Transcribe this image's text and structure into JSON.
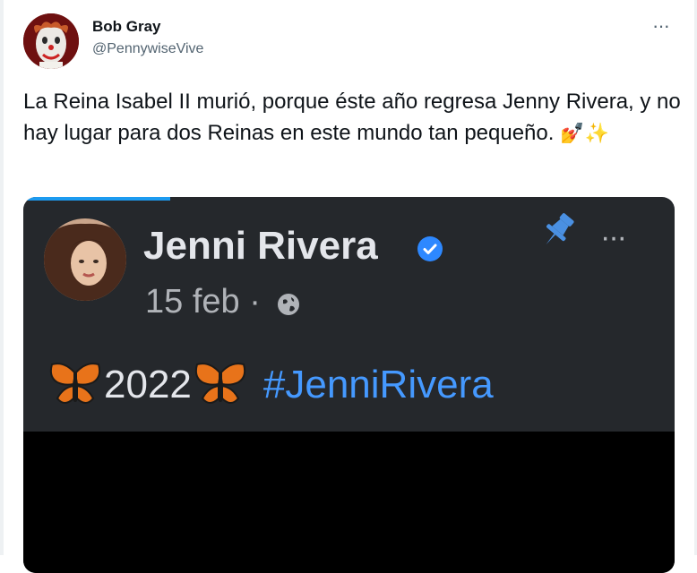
{
  "tweet": {
    "author_name": "Bob Gray",
    "author_handle": "@PennywiseVive",
    "more_label": "···",
    "text": "La Reina Isabel II murió, porque éste año regresa Jenny Rivera, y no hay lugar para dos Reinas en este mundo tan pequeño.",
    "text_emojis": "💅✨"
  },
  "embedded_post": {
    "name": "Jenni Rivera",
    "date": "15 feb ·",
    "more_label": "···",
    "year": "2022",
    "hashtag": "#JenniRivera"
  },
  "colors": {
    "accent": "#1d9bf0",
    "hashtag": "#4599ff",
    "media_bg": "#25282c"
  },
  "icons": [
    "profile-avatar",
    "more-icon",
    "verified-badge-icon",
    "globe-icon",
    "pin-icon",
    "butterfly-icon"
  ]
}
